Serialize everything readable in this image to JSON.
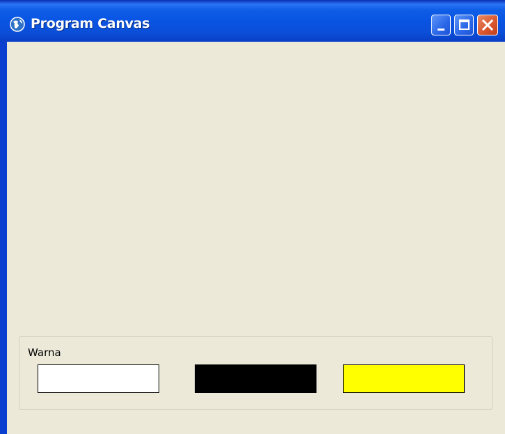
{
  "window": {
    "title": "Program Canvas",
    "icon": "globe-icon",
    "controls": [
      "minimize-icon",
      "maximize-icon",
      "close-icon"
    ]
  },
  "colors": {
    "titlebar": "#0954e3",
    "client_background": "#ece9d8"
  },
  "color_group": {
    "label": "Warna",
    "swatches": [
      {
        "name": "white",
        "color": "#ffffff"
      },
      {
        "name": "black",
        "color": "#000000"
      },
      {
        "name": "yellow",
        "color": "#ffff00"
      }
    ]
  }
}
